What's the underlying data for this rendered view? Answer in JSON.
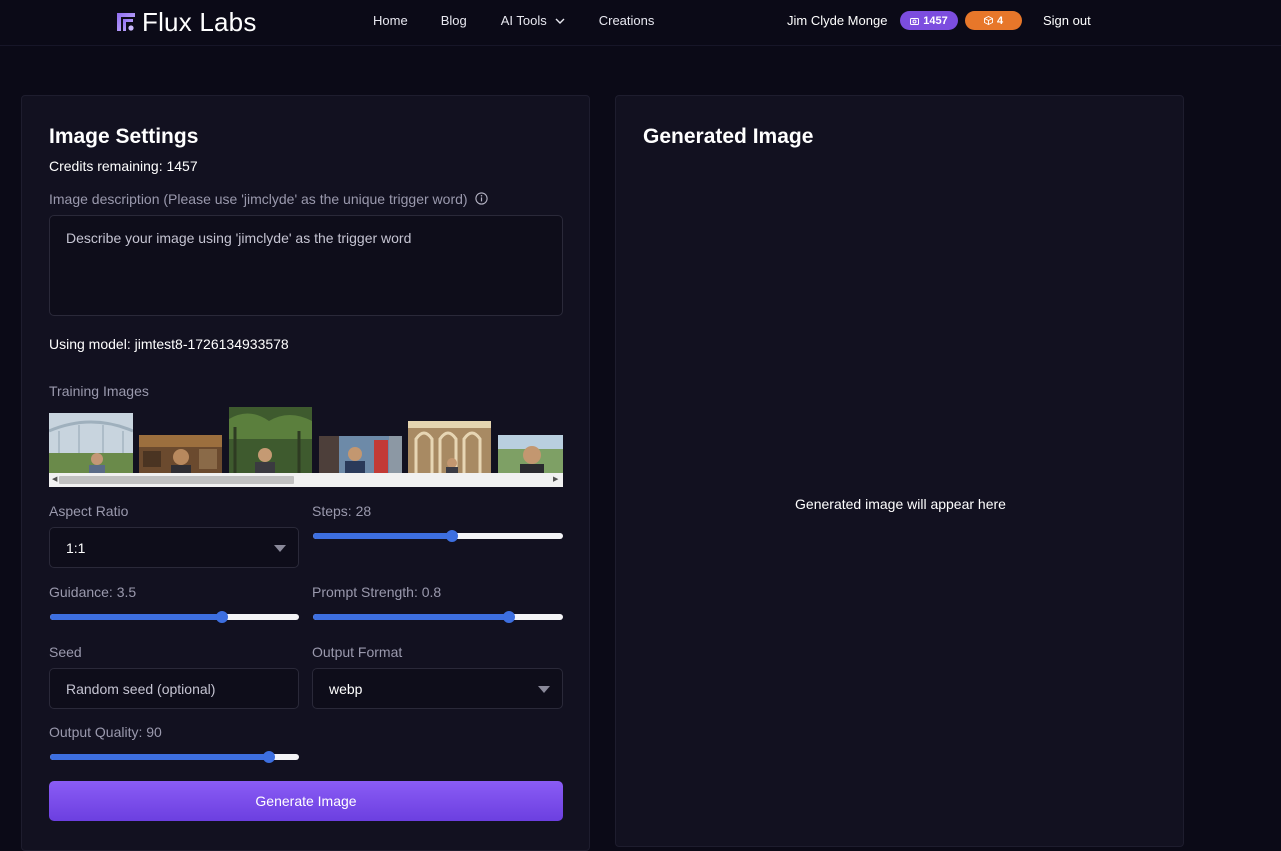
{
  "nav": {
    "brand": "Flux Labs",
    "links": [
      "Home",
      "Blog",
      "AI Tools",
      "Creations"
    ],
    "user_name": "Jim Clyde Monge",
    "credits_badge": "1457",
    "models_badge": "4",
    "sign_out": "Sign out"
  },
  "settings": {
    "title": "Image Settings",
    "credits_text": "Credits remaining: 1457",
    "description_label": "Image description (Please use 'jimclyde' as the unique trigger word)",
    "description_placeholder": "Describe your image using 'jimclyde' as the trigger word",
    "model_text": "Using model: jimtest8-1726134933578",
    "training_label": "Training Images",
    "training_images": [
      "photo-1",
      "photo-2",
      "photo-3",
      "photo-4",
      "photo-5",
      "photo-6"
    ],
    "aspect_label": "Aspect Ratio",
    "aspect_value": "1:1",
    "steps_label": "Steps: 28",
    "steps_value": 28,
    "guidance_label": "Guidance: 3.5",
    "guidance_value": 3.5,
    "prompt_strength_label": "Prompt Strength: 0.8",
    "prompt_strength_value": 0.8,
    "seed_label": "Seed",
    "seed_placeholder": "Random seed (optional)",
    "format_label": "Output Format",
    "format_value": "webp",
    "quality_label": "Output Quality: 90",
    "quality_value": 90,
    "generate_button": "Generate Image"
  },
  "output": {
    "title": "Generated Image",
    "placeholder": "Generated image will appear here"
  },
  "colors": {
    "accent_blue": "#3d6fe0",
    "accent_purple": "#7c4ddf",
    "accent_orange": "#e7772a"
  }
}
